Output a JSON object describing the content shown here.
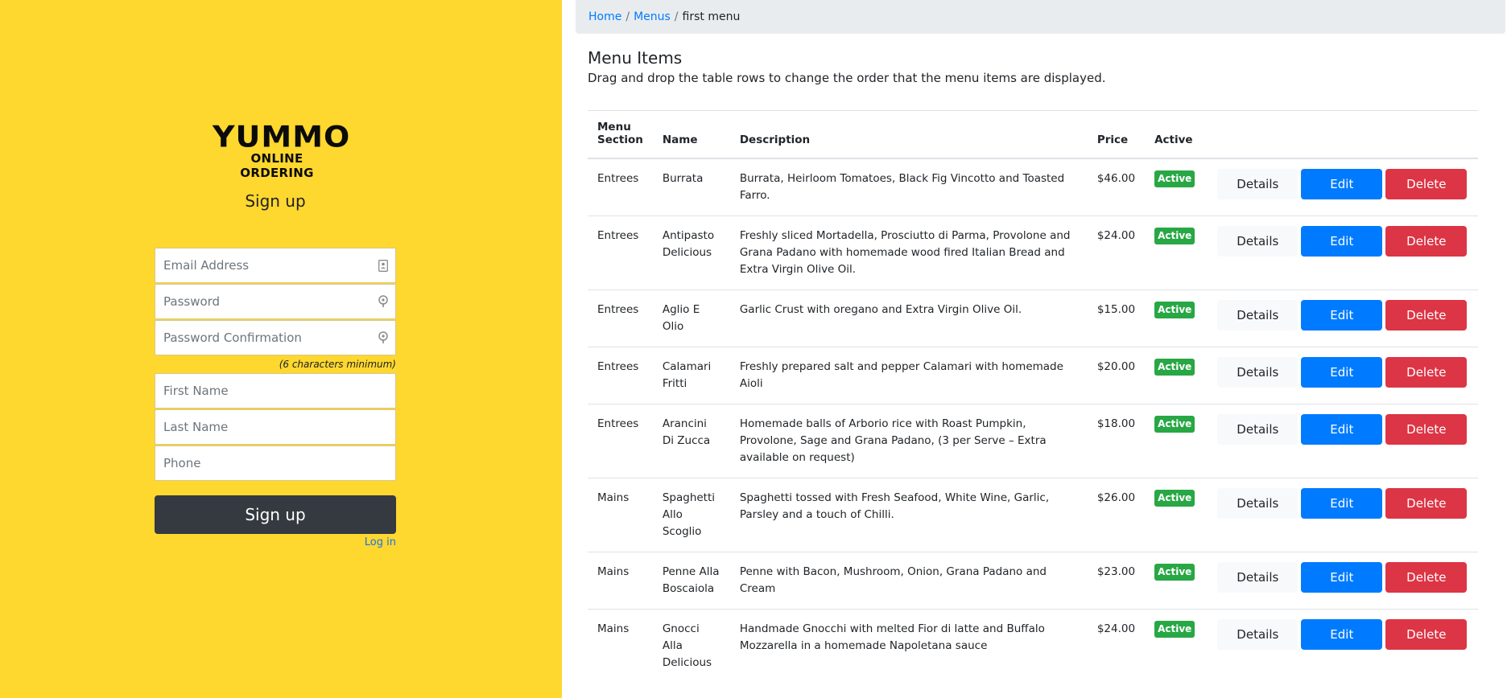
{
  "signup": {
    "logo_main": "YUMMO",
    "logo_sub": "ONLINE ORDERING",
    "title": "Sign up",
    "email_placeholder": "Email Address",
    "password_placeholder": "Password",
    "password_confirm_placeholder": "Password Confirmation",
    "password_hint": "(6 characters minimum)",
    "first_name_placeholder": "First Name",
    "last_name_placeholder": "Last Name",
    "phone_placeholder": "Phone",
    "submit_label": "Sign up",
    "login_link": "Log in"
  },
  "breadcrumb": {
    "home": "Home",
    "menus": "Menus",
    "separator": "/",
    "current": "first menu"
  },
  "main": {
    "title": "Menu Items",
    "subtitle": "Drag and drop the table rows to change the order that the menu items are displayed.",
    "columns": {
      "section": "Menu Section",
      "name": "Name",
      "description": "Description",
      "price": "Price",
      "active": "Active"
    },
    "buttons": {
      "details": "Details",
      "edit": "Edit",
      "delete": "Delete"
    },
    "rows": [
      {
        "section": "Entrees",
        "name": "Burrata",
        "description": "Burrata, Heirloom Tomatoes, Black Fig Vincotto and Toasted Farro.",
        "price": "$46.00",
        "status": "Active"
      },
      {
        "section": "Entrees",
        "name": "Antipasto Delicious",
        "description": "Freshly sliced Mortadella, Prosciutto di Parma, Provolone and Grana Padano with homemade wood fired Italian Bread and Extra Virgin Olive Oil.",
        "price": "$24.00",
        "status": "Active"
      },
      {
        "section": "Entrees",
        "name": "Aglio E Olio",
        "description": "Garlic Crust with oregano and Extra Virgin Olive Oil.",
        "price": "$15.00",
        "status": "Active"
      },
      {
        "section": "Entrees",
        "name": "Calamari Fritti",
        "description": "Freshly prepared salt and pepper Calamari with homemade Aioli",
        "price": "$20.00",
        "status": "Active"
      },
      {
        "section": "Entrees",
        "name": "Arancini Di Zucca",
        "description": "Homemade balls of Arborio rice with Roast Pumpkin, Provolone, Sage and Grana Padano, (3 per Serve – Extra available on request)",
        "price": "$18.00",
        "status": "Active"
      },
      {
        "section": "Mains",
        "name": "Spaghetti Allo Scoglio",
        "description": "Spaghetti tossed with Fresh Seafood, White Wine, Garlic, Parsley and a touch of Chilli.",
        "price": "$26.00",
        "status": "Active"
      },
      {
        "section": "Mains",
        "name": "Penne Alla Boscaiola",
        "description": "Penne with Bacon, Mushroom, Onion, Grana Padano and Cream",
        "price": "$23.00",
        "status": "Active"
      },
      {
        "section": "Mains",
        "name": "Gnocci Alla Delicious",
        "description": "Handmade Gnocchi with melted Fior di latte and Buffalo Mozzarella in a homemade Napoletana sauce",
        "price": "$24.00",
        "status": "Active"
      }
    ]
  },
  "colors": {
    "left_panel": "#fed72f",
    "signup_button": "#343a40",
    "edit_button": "#007bff",
    "delete_button": "#dc3545",
    "details_button": "#f8f9fa",
    "active_badge": "#28a745",
    "link": "#007bff"
  },
  "icons": {
    "email": "contact-card-icon",
    "password": "key-icon",
    "password_confirm": "key-icon"
  }
}
